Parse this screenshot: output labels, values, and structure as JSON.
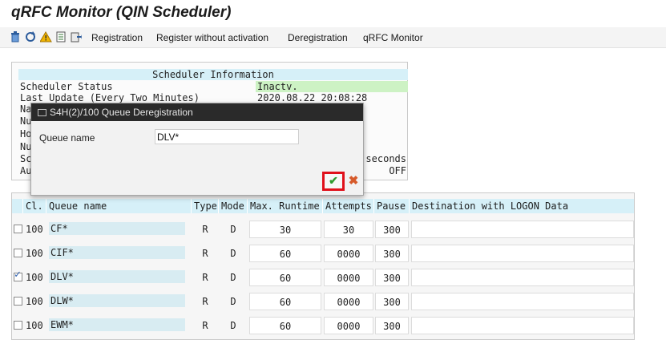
{
  "title": "qRFC Monitor (QIN Scheduler)",
  "toolbar": {
    "icons": [
      "trash-icon",
      "refresh-icon",
      "warning-icon",
      "document-icon",
      "export-icon"
    ],
    "buttons": [
      "Registration",
      "Register without activation",
      "Deregistration",
      "qRFC Monitor"
    ]
  },
  "scheduler": {
    "header": "Scheduler Information",
    "rows": [
      {
        "label": "Scheduler Status",
        "value": "Inactv."
      },
      {
        "label": "Last Update (Every Two Minutes)",
        "value": "2020.08.22 20:08:28"
      },
      {
        "label": "Na",
        "value": ""
      },
      {
        "label": "Nu",
        "value": ""
      },
      {
        "label": "Ho",
        "value": ""
      },
      {
        "label": "Nu",
        "value": ""
      },
      {
        "label": "Sc",
        "value": "seconds"
      },
      {
        "label": "Au",
        "value": "OFF"
      }
    ]
  },
  "dialog": {
    "title": "S4H(2)/100 Queue Deregistration",
    "queue_label": "Queue name",
    "queue_value": "DLV*",
    "ok_icon": "check-icon",
    "cancel_icon": "cancel-icon"
  },
  "table": {
    "headers": [
      "Cl.",
      "Queue name",
      "Type",
      "Mode",
      "Max. Runtime",
      "Attempts",
      "Pause",
      "Destination with LOGON Data"
    ],
    "rows": [
      {
        "checked": false,
        "client": "100",
        "queue": "CF*",
        "type": "R",
        "mode": "D",
        "runtime": "30",
        "attempts": "30",
        "pause": "300",
        "dest": ""
      },
      {
        "checked": false,
        "client": "100",
        "queue": "CIF*",
        "type": "R",
        "mode": "D",
        "runtime": "60",
        "attempts": "0000",
        "pause": "300",
        "dest": ""
      },
      {
        "checked": true,
        "client": "100",
        "queue": "DLV*",
        "type": "R",
        "mode": "D",
        "runtime": "60",
        "attempts": "0000",
        "pause": "300",
        "dest": ""
      },
      {
        "checked": false,
        "client": "100",
        "queue": "DLW*",
        "type": "R",
        "mode": "D",
        "runtime": "60",
        "attempts": "0000",
        "pause": "300",
        "dest": ""
      },
      {
        "checked": false,
        "client": "100",
        "queue": "EWM*",
        "type": "R",
        "mode": "D",
        "runtime": "60",
        "attempts": "0000",
        "pause": "300",
        "dest": ""
      }
    ]
  },
  "colors": {
    "accent_header": "#d6f0f8",
    "status_green": "#cdf2c4",
    "highlight_red": "#e0101b"
  }
}
